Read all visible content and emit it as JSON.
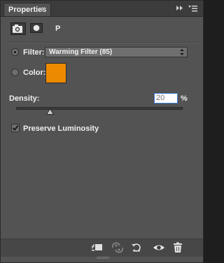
{
  "panel": {
    "tab_label": "Properties",
    "tab_close_glyph": "×",
    "adjustment_label": "P"
  },
  "filter": {
    "label": "Filter:",
    "selected": "Warming Filter (85)",
    "mode_selected": "filter"
  },
  "color": {
    "label": "Color:",
    "swatch_color": "#ec8a00"
  },
  "density": {
    "label": "Density:",
    "value": "20",
    "unit": "%",
    "slider_fraction": 0.2
  },
  "preserve_luminosity": {
    "label": "Preserve Luminosity",
    "checked": true
  },
  "footer": {
    "icons": [
      "clip-to-layer-icon",
      "view-previous-state-icon",
      "reset-icon",
      "visibility-eye-icon",
      "trash-icon"
    ]
  }
}
